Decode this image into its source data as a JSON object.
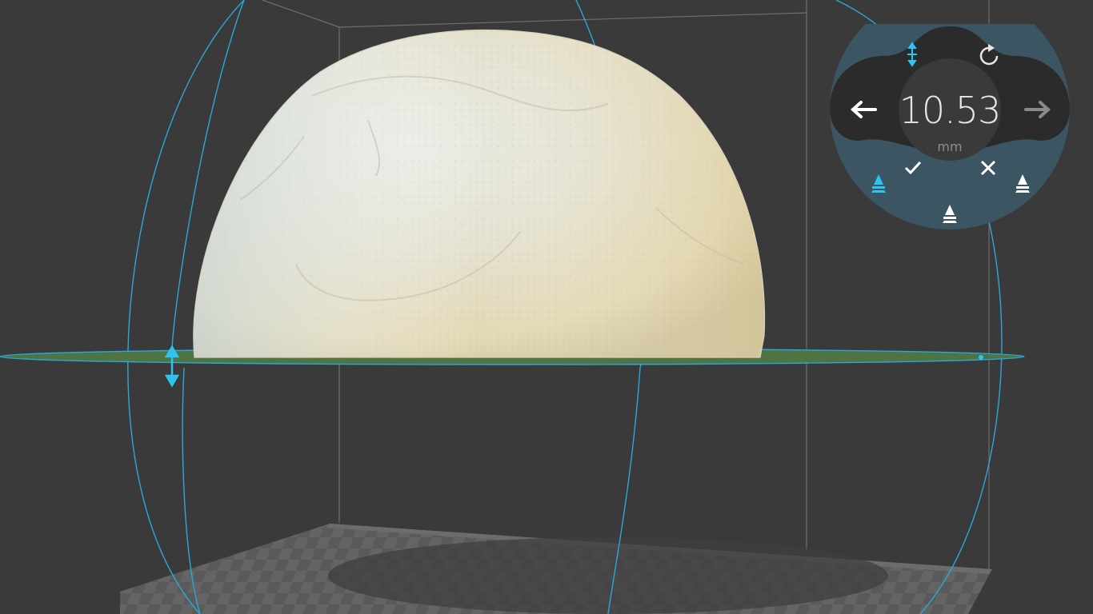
{
  "gizmo": {
    "value": "10.53",
    "unit": "mm"
  },
  "icons": {
    "move_vertical": "move-vertical-icon",
    "rotate": "rotate-icon",
    "back": "arrow-left-icon",
    "forward": "arrow-right-icon",
    "confirm": "checkmark-icon",
    "cancel": "close-icon",
    "snap_top": "snap-top-icon",
    "snap_left": "snap-left-icon",
    "snap_right": "snap-right-icon"
  },
  "colors": {
    "background": "#3a3a3a",
    "accent": "#29b6e8",
    "gizmo_dark": "#2b2b2b",
    "gizmo_teal": "#3b5563",
    "plane_green": "#4f7342",
    "model": "#e8e3d2"
  }
}
